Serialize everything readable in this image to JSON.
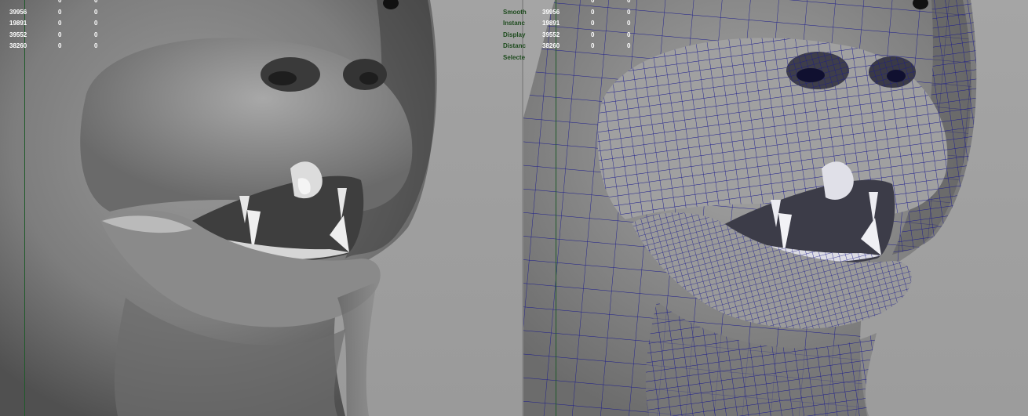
{
  "left_viewport": {
    "hud_rows": [
      {
        "count": "39956",
        "a": "0",
        "b": "0"
      },
      {
        "count": "19891",
        "a": "0",
        "b": "0"
      },
      {
        "count": "39552",
        "a": "0",
        "b": "0"
      },
      {
        "count": "38260",
        "a": "0",
        "b": "0"
      }
    ]
  },
  "right_viewport": {
    "hud_labels": [
      "Smooth",
      "Instanc",
      "Display",
      "Distanc",
      "Selecte"
    ],
    "hud_rows": [
      {
        "count": "39956",
        "a": "0",
        "b": "0"
      },
      {
        "count": "19891",
        "a": "0",
        "b": "0"
      },
      {
        "count": "39552",
        "a": "0",
        "b": "0"
      },
      {
        "count": "38260",
        "a": "0",
        "b": "0"
      }
    ],
    "wireframe_color": "#1a1a8c"
  },
  "colors": {
    "background": "#9b9b9b",
    "axis_green": "#1f5a2a",
    "hud_label_green": "#1e4b1e"
  }
}
